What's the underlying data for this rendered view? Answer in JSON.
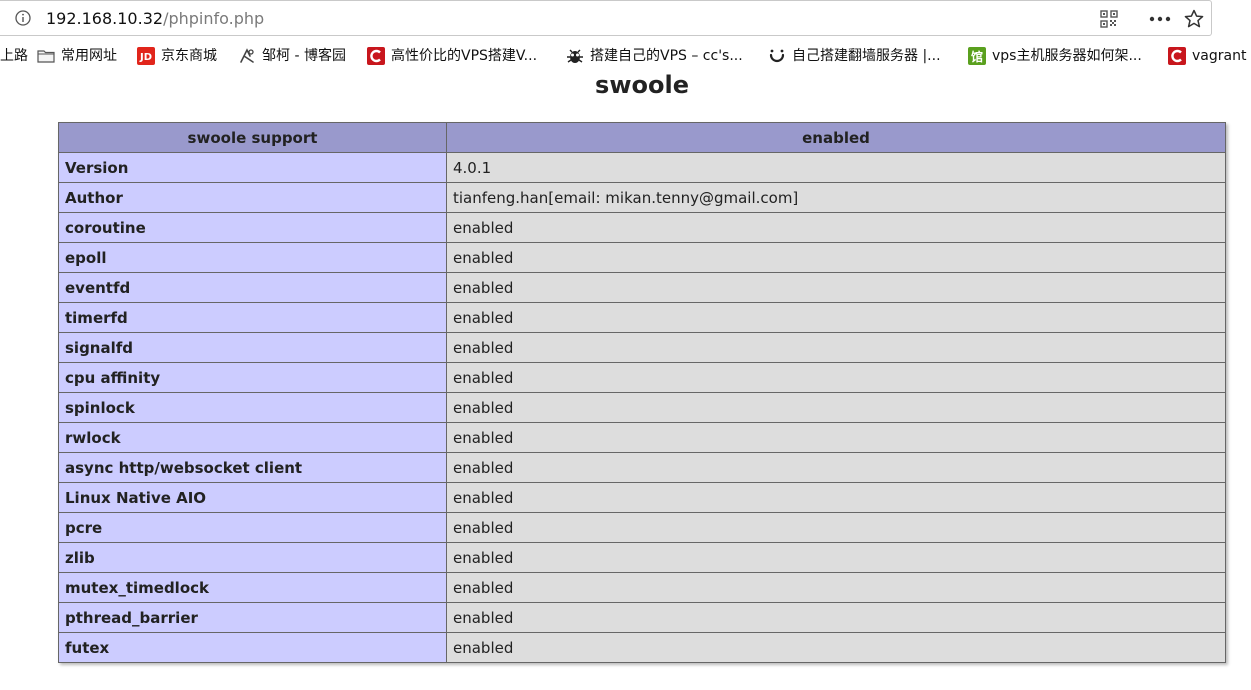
{
  "browser": {
    "url_host": "192.168.10.32",
    "url_path": "/phpinfo.php"
  },
  "bookmarks": [
    {
      "label": "上路",
      "icon": "none"
    },
    {
      "label": "常用网址",
      "icon": "folder-icon"
    },
    {
      "label": "京东商城",
      "icon": "jd-icon"
    },
    {
      "label": "邹柯 - 博客园",
      "icon": "cnblogs-icon"
    },
    {
      "label": "高性价比的VPS搭建V...",
      "icon": "red-c-icon"
    },
    {
      "label": "搭建自己的VPS – cc's...",
      "icon": "bug-icon"
    },
    {
      "label": "自己搭建翻墙服务器 |...",
      "icon": "smile-icon"
    },
    {
      "label": "vps主机服务器如何架...",
      "icon": "green-icon"
    },
    {
      "label": "vagrant",
      "icon": "red-c-icon"
    }
  ],
  "page": {
    "title": "swoole"
  },
  "table": {
    "header": [
      "swoole support",
      "enabled"
    ],
    "rows": [
      [
        "Version",
        "4.0.1"
      ],
      [
        "Author",
        "tianfeng.han[email: mikan.tenny@gmail.com]"
      ],
      [
        "coroutine",
        "enabled"
      ],
      [
        "epoll",
        "enabled"
      ],
      [
        "eventfd",
        "enabled"
      ],
      [
        "timerfd",
        "enabled"
      ],
      [
        "signalfd",
        "enabled"
      ],
      [
        "cpu affinity",
        "enabled"
      ],
      [
        "spinlock",
        "enabled"
      ],
      [
        "rwlock",
        "enabled"
      ],
      [
        "async http/websocket client",
        "enabled"
      ],
      [
        "Linux Native AIO",
        "enabled"
      ],
      [
        "pcre",
        "enabled"
      ],
      [
        "zlib",
        "enabled"
      ],
      [
        "mutex_timedlock",
        "enabled"
      ],
      [
        "pthread_barrier",
        "enabled"
      ],
      [
        "futex",
        "enabled"
      ]
    ]
  },
  "colors": {
    "header_bg": "#9999cc",
    "key_bg": "#ccccff",
    "value_bg": "#dddddd"
  }
}
